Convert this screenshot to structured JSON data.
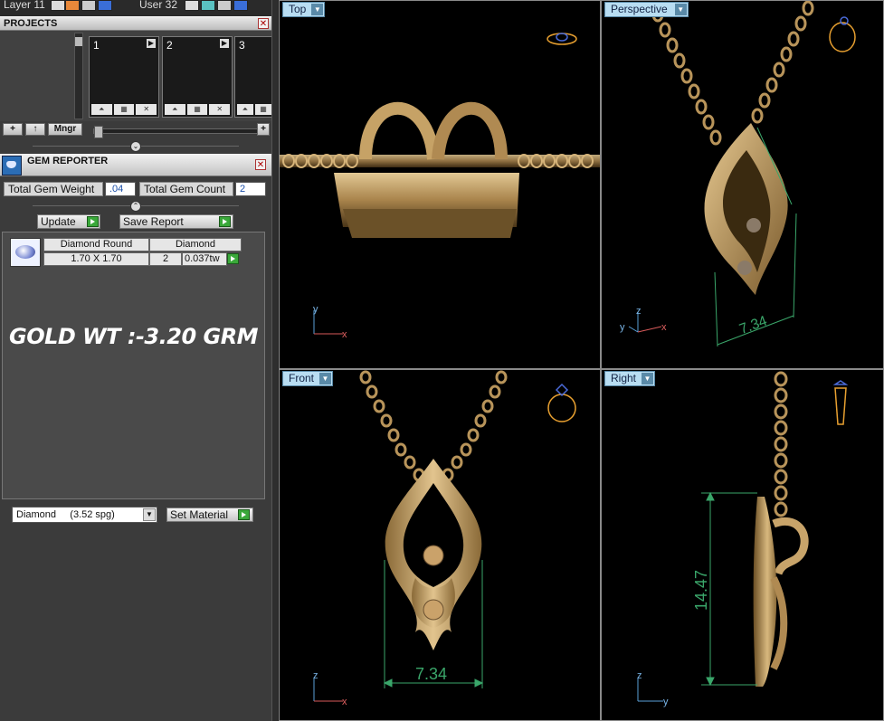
{
  "topbar": {
    "layer_label": "Layer 11",
    "user_label": "User 32"
  },
  "projects": {
    "header": "PROJECTS",
    "cards": [
      {
        "number": "1"
      },
      {
        "number": "2"
      },
      {
        "number": "3"
      }
    ],
    "buttons": {
      "add": "+",
      "up": "↑",
      "manager": "Mngr",
      "plus": "+"
    }
  },
  "gem_reporter": {
    "title": "GEM REPORTER",
    "total_weight_label": "Total Gem Weight",
    "total_weight_value": ".04",
    "total_count_label": "Total Gem Count",
    "total_count_value": "2",
    "update_label": "Update",
    "save_report_label": "Save Report",
    "table": {
      "headers": [
        "Diamond Round",
        "Diamond"
      ],
      "row": {
        "size": "1.70 X 1.70",
        "count": "2",
        "weight": "0.037tw"
      }
    }
  },
  "annotation": "GOLD WT :-3.20 GRM",
  "material": {
    "selected": "Diamond     (3.52 spg)",
    "set_label": "Set Material"
  },
  "viewports": {
    "top": {
      "label": "Top",
      "axes": [
        "y",
        "x"
      ]
    },
    "perspective": {
      "label": "Perspective",
      "dimension": "7.34",
      "axes": [
        "z",
        "y",
        "x"
      ]
    },
    "front": {
      "label": "Front",
      "dimension": "7.34",
      "axes": [
        "z",
        "x"
      ]
    },
    "right": {
      "label": "Right",
      "dimension": "14.47",
      "axes": [
        "z",
        "y"
      ]
    }
  },
  "colors": {
    "gold": "#b8945a",
    "dimension_line": "#3aa66a",
    "tab_bg": "#b8ddf2",
    "green_button": "#3aa83a"
  }
}
